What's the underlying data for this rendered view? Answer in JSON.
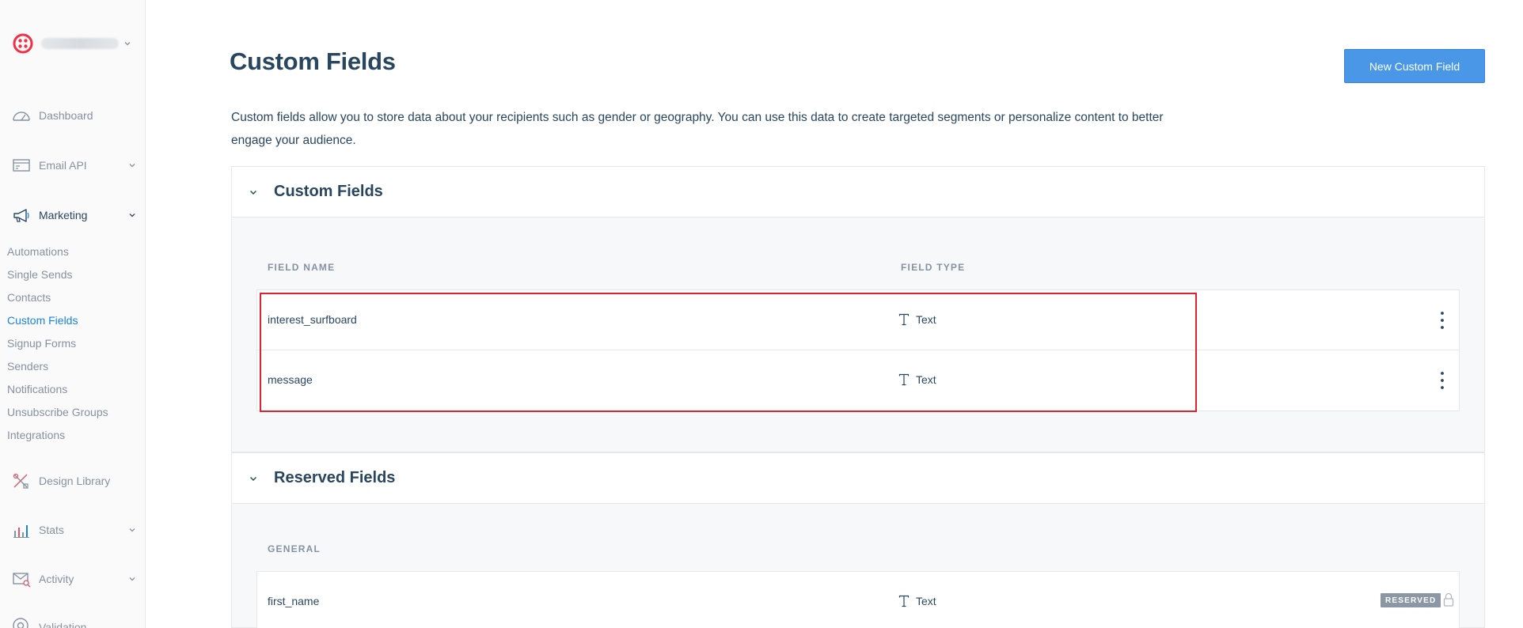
{
  "sidebar": {
    "nav": [
      {
        "label": "Dashboard",
        "icon": "dashboard-gauge-icon",
        "has_chevron": false
      },
      {
        "label": "Email API",
        "icon": "email-api-icon",
        "has_chevron": true
      },
      {
        "label": "Marketing",
        "icon": "megaphone-icon",
        "has_chevron": true
      }
    ],
    "marketing_items": [
      "Automations",
      "Single Sends",
      "Contacts",
      "Custom Fields",
      "Signup Forms",
      "Senders",
      "Notifications",
      "Unsubscribe Groups",
      "Integrations"
    ],
    "active_item": "Custom Fields",
    "lower_nav": [
      {
        "label": "Design Library",
        "icon": "design-tools-icon",
        "has_chevron": false
      },
      {
        "label": "Stats",
        "icon": "bar-chart-icon",
        "has_chevron": true
      },
      {
        "label": "Activity",
        "icon": "activity-envelope-icon",
        "has_chevron": true
      },
      {
        "label": "Validation",
        "icon": "at-sign-icon",
        "has_chevron": false
      }
    ]
  },
  "header": {
    "title": "Custom Fields",
    "new_button": "New Custom Field",
    "description": "Custom fields allow you to store data about your recipients such as gender or geography. You can use this data to create targeted segments or personalize content to better engage your audience."
  },
  "custom_section": {
    "title": "Custom Fields",
    "col_name": "FIELD NAME",
    "col_type": "FIELD TYPE",
    "rows": [
      {
        "name": "interest_surfboard",
        "type": "Text"
      },
      {
        "name": "message",
        "type": "Text"
      }
    ]
  },
  "reserved_section": {
    "title": "Reserved Fields",
    "group": "GENERAL",
    "rows": [
      {
        "name": "first_name",
        "type": "Text",
        "badge": "RESERVED"
      }
    ]
  },
  "colors": {
    "accent": "#1a82e2",
    "button": "#4a97e8",
    "highlight": "#e0222f",
    "text": "#294661",
    "muted": "#8592a0",
    "logo": "#f22f46"
  }
}
